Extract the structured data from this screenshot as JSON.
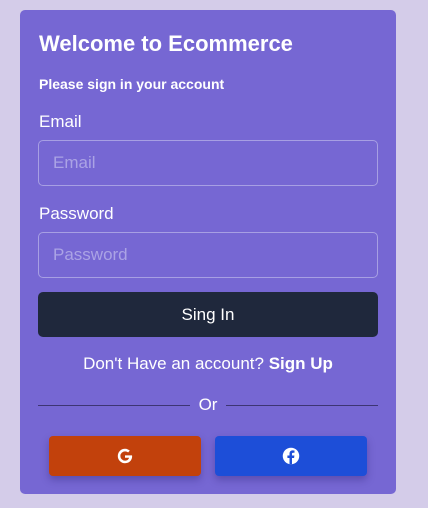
{
  "colors": {
    "page_background": "#d4cce9",
    "card_background": "#7667d3",
    "signin_button": "#1f283c",
    "google_button": "#c2410c",
    "facebook_button": "#1d4ed8"
  },
  "form": {
    "title": "Welcome to Ecommerce",
    "subtitle": "Please sign in your account",
    "email": {
      "label": "Email",
      "placeholder": "Email",
      "value": ""
    },
    "password": {
      "label": "Password",
      "placeholder": "Password",
      "value": ""
    },
    "submit_label": "Sing In",
    "signup_prompt": "Don't Have an account?",
    "signup_link": "Sign Up",
    "divider_text": "Or"
  },
  "social": [
    {
      "provider": "Google",
      "icon": "google-icon"
    },
    {
      "provider": "Facebook",
      "icon": "facebook-icon"
    }
  ]
}
